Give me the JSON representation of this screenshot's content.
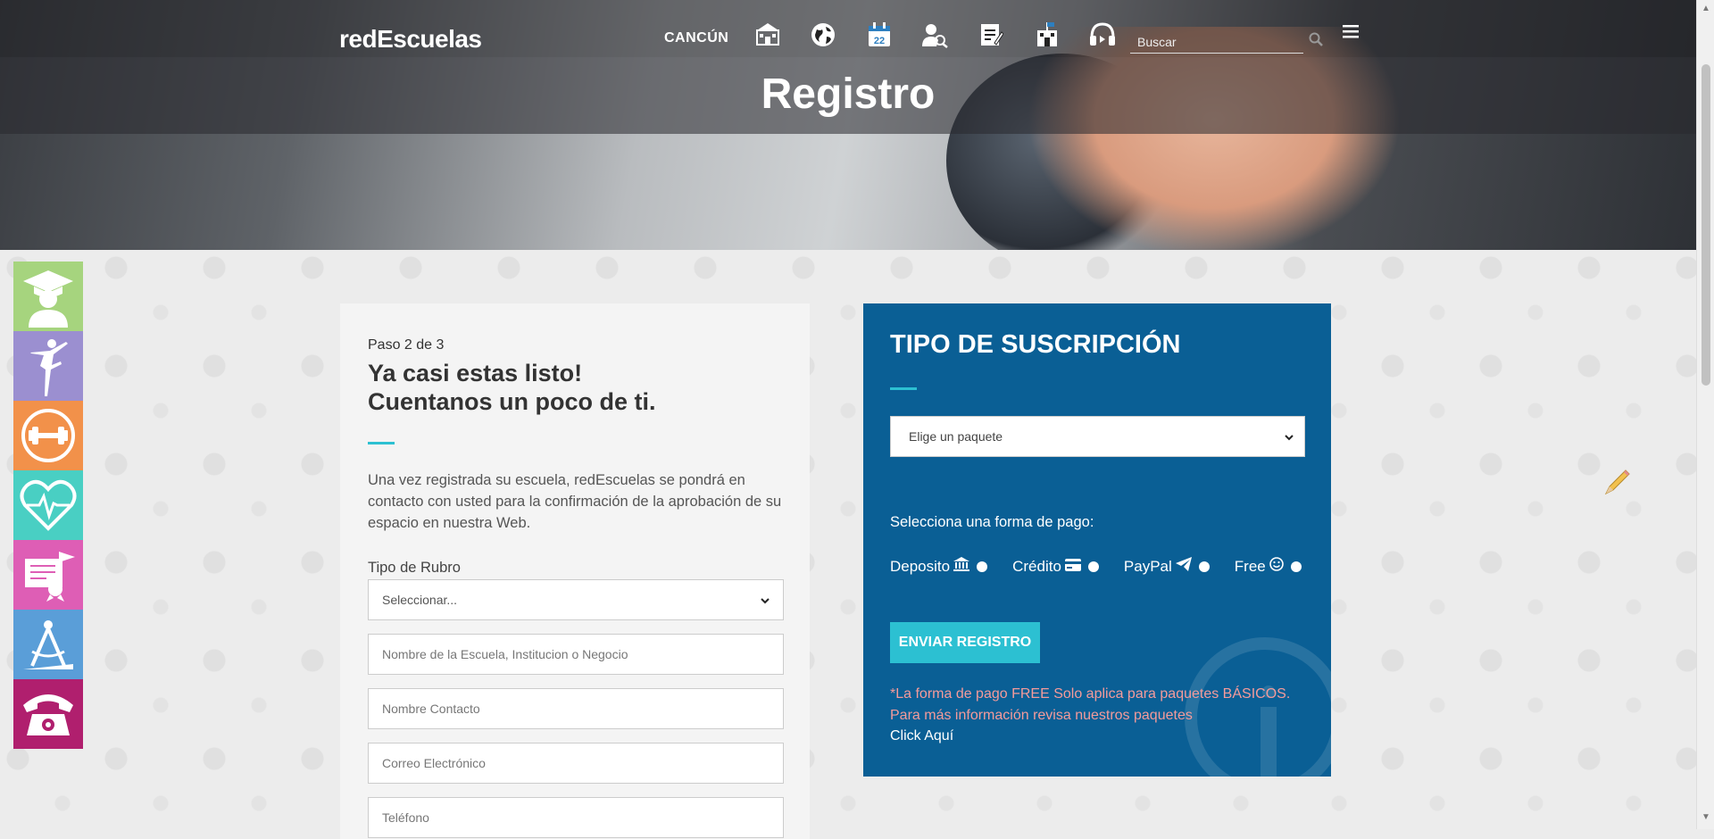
{
  "header": {
    "logo_text": "redEscuelas",
    "city": "CANCÚN",
    "nav_icons": [
      "school-icon",
      "globe-icon",
      "calendar-icon",
      "user-search-icon",
      "notes-icon",
      "flag-school-icon",
      "headset-icon"
    ],
    "calendar_day": "22",
    "search_placeholder": "Buscar",
    "page_title": "Registro"
  },
  "sidebar": {
    "tiles": [
      {
        "name": "graduate",
        "color": "#a6d47e"
      },
      {
        "name": "ballet",
        "color": "#9b8fd0"
      },
      {
        "name": "fitness",
        "color": "#f2914a"
      },
      {
        "name": "health",
        "color": "#49cfc3"
      },
      {
        "name": "diploma",
        "color": "#de5eb5"
      },
      {
        "name": "tools",
        "color": "#5a9ed8"
      },
      {
        "name": "phone",
        "color": "#b01f6e"
      }
    ]
  },
  "form": {
    "step": "Paso 2 de 3",
    "heading_line1": "Ya casi estas listo!",
    "heading_line2": "Cuentanos un poco de ti.",
    "description": "Una vez registrada su escuela, redEscuelas se pondrá en contacto con usted para la confirmación de la aprobación de su espacio en nuestra Web.",
    "rubro_label": "Tipo de Rubro",
    "rubro_value": "Seleccionar...",
    "name_placeholder": "Nombre de la Escuela, Institucion o Negocio",
    "contact_placeholder": "Nombre Contacto",
    "email_placeholder": "Correo Electrónico",
    "phone_placeholder": "Teléfono"
  },
  "subscription": {
    "title": "TIPO DE SUSCRIPCIÓN",
    "package_value": "Elige un paquete",
    "payment_label": "Selecciona una forma de pago:",
    "payment_options": [
      {
        "label": "Deposito",
        "icon": "bank-icon",
        "glyph": "🏛"
      },
      {
        "label": "Crédito",
        "icon": "credit-card-icon",
        "glyph": "💳"
      },
      {
        "label": "PayPal",
        "icon": "paper-plane-icon",
        "glyph": "✈"
      },
      {
        "label": "Free",
        "icon": "smile-icon",
        "glyph": "☺"
      }
    ],
    "send_button": "ENVIAR REGISTRO",
    "note": "*La forma de pago FREE Solo aplica para paquetes BÁSICOS. Para más información revisa nuestros paquetes",
    "note_link": "Click Aquí"
  }
}
